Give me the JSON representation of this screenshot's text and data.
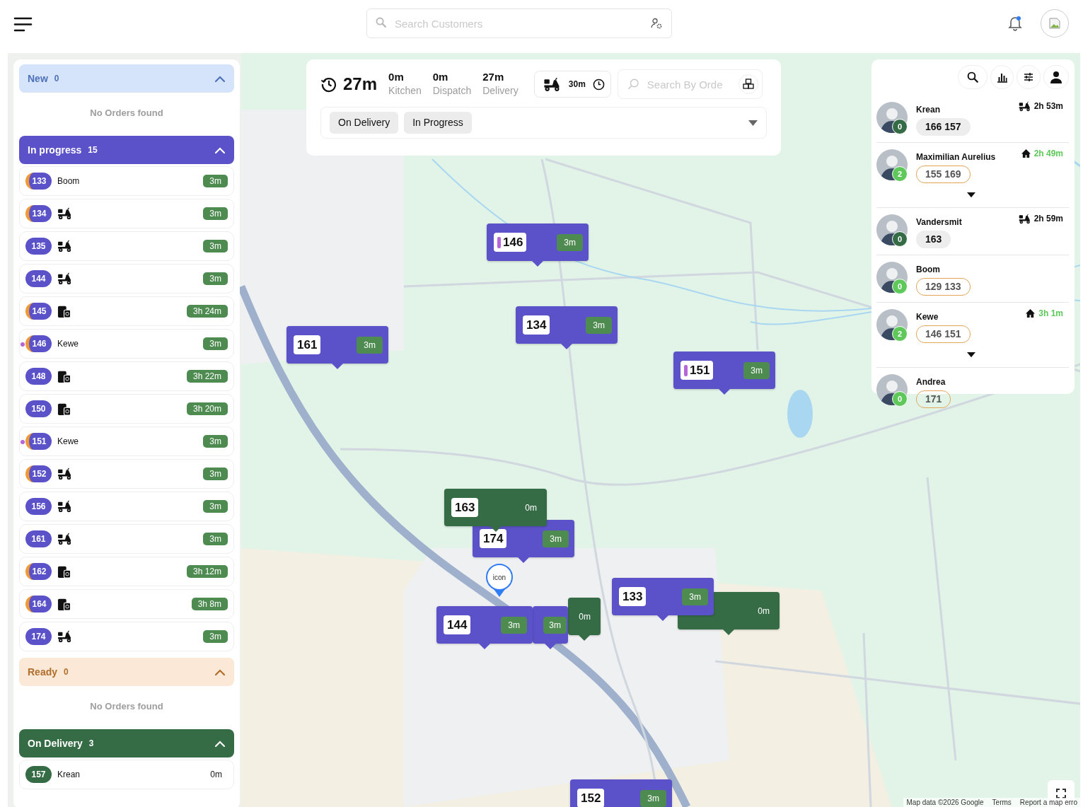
{
  "header": {
    "search": {
      "placeholder": "Search Customers"
    },
    "notifications": {
      "unread": true
    }
  },
  "order_sections": [
    {
      "title": "New",
      "count": "0",
      "kind": "new",
      "expanded": true,
      "empty_text": "No Orders found"
    },
    {
      "title": "In progress",
      "count": "15",
      "kind": "progress",
      "expanded": true,
      "orders": [
        {
          "number": "133",
          "flagged": true,
          "kind": "driver",
          "driver": "Boom",
          "time": "3m"
        },
        {
          "number": "134",
          "flagged": true,
          "kind": "delivery",
          "time": "3m"
        },
        {
          "number": "135",
          "flagged": false,
          "kind": "delivery",
          "time": "3m"
        },
        {
          "number": "144",
          "flagged": false,
          "kind": "delivery",
          "time": "3m"
        },
        {
          "number": "145",
          "flagged": true,
          "kind": "pickup",
          "time": "3h 24m"
        },
        {
          "number": "146",
          "flagged": true,
          "kind": "driver",
          "driver": "Kewe",
          "color": "#b566d9",
          "time": "3m"
        },
        {
          "number": "148",
          "flagged": false,
          "kind": "pickup",
          "time": "3h 22m"
        },
        {
          "number": "150",
          "flagged": false,
          "kind": "pickup",
          "time": "3h 20m"
        },
        {
          "number": "151",
          "flagged": true,
          "kind": "driver",
          "driver": "Kewe",
          "color": "#b566d9",
          "time": "3m"
        },
        {
          "number": "152",
          "flagged": true,
          "kind": "delivery",
          "time": "3m"
        },
        {
          "number": "156",
          "flagged": false,
          "kind": "delivery",
          "time": "3m"
        },
        {
          "number": "161",
          "flagged": false,
          "kind": "delivery",
          "time": "3m"
        },
        {
          "number": "162",
          "flagged": true,
          "kind": "pickup",
          "time": "3h 12m"
        },
        {
          "number": "164",
          "flagged": true,
          "kind": "pickup",
          "time": "3h 8m"
        },
        {
          "number": "174",
          "flagged": false,
          "kind": "delivery",
          "time": "3m"
        }
      ]
    },
    {
      "title": "Ready",
      "count": "0",
      "kind": "ready",
      "expanded": true,
      "empty_text": "No Orders found"
    },
    {
      "title": "On Delivery",
      "count": "3",
      "kind": "delivery",
      "expanded": true,
      "orders": [
        {
          "number": "157",
          "flagged": false,
          "kind": "driver",
          "driver": "Krean",
          "time": "0m"
        }
      ]
    }
  ],
  "summary": {
    "total": "27m",
    "stats": [
      {
        "value": "0m",
        "label": "Kitchen"
      },
      {
        "value": "0m",
        "label": "Dispatch"
      },
      {
        "value": "27m",
        "label": "Delivery"
      }
    ],
    "delivery_time": "30m",
    "order_search": {
      "placeholder": "Search By Orde"
    },
    "filters": [
      {
        "label": "On Delivery"
      },
      {
        "label": "In Progress"
      }
    ]
  },
  "drivers": [
    {
      "name": "Krean",
      "count": "0",
      "kind": "delivering",
      "time": "2h 53m",
      "orders": [
        "166",
        "157"
      ],
      "expandable": false
    },
    {
      "name": "Maximilian Aurelius",
      "count": "2",
      "kind": "returning",
      "time": "2h 49m",
      "orders": [
        "155",
        "169"
      ],
      "expandable": true
    },
    {
      "name": "Vandersmit",
      "count": "0",
      "kind": "delivering",
      "time": "2h 59m",
      "orders": [
        "163"
      ],
      "expandable": false
    },
    {
      "name": "Boom",
      "count": "0",
      "kind": "idle",
      "orders": [
        "129",
        "133"
      ],
      "expandable": false
    },
    {
      "name": "Kewe",
      "count": "2",
      "kind": "returning",
      "time": "3h 1m",
      "orders": [
        "146",
        "151"
      ],
      "expandable": true
    },
    {
      "name": "Andrea",
      "count": "0",
      "kind": "idle",
      "orders": [
        "171"
      ],
      "expandable": false
    }
  ],
  "map": {
    "markers": [
      {
        "kind": "progress",
        "number": "146",
        "color": "#b566d9",
        "time": "3m"
      },
      {
        "kind": "progress",
        "number": "134",
        "time": "3m"
      },
      {
        "kind": "progress",
        "number": "161",
        "time": "3m"
      },
      {
        "kind": "progress",
        "number": "151",
        "color": "#b566d9",
        "time": "3m"
      },
      {
        "kind": "progress",
        "number": "174",
        "time": "3m"
      },
      {
        "kind": "delivery",
        "number": "163",
        "time": "0m"
      },
      {
        "kind": "delivery",
        "time": "0m"
      },
      {
        "kind": "progress",
        "time": "3m"
      },
      {
        "kind": "progress",
        "number": "144",
        "time": "3m"
      },
      {
        "kind": "delivery",
        "time": "0m"
      },
      {
        "kind": "progress",
        "number": "133",
        "time": "3m"
      },
      {
        "kind": "progress",
        "number": "152",
        "time": "3m"
      }
    ],
    "pin": {
      "label": "icon"
    },
    "attribution": [
      "Map data ©2026 Google",
      "Terms",
      "Report a map erro"
    ]
  }
}
